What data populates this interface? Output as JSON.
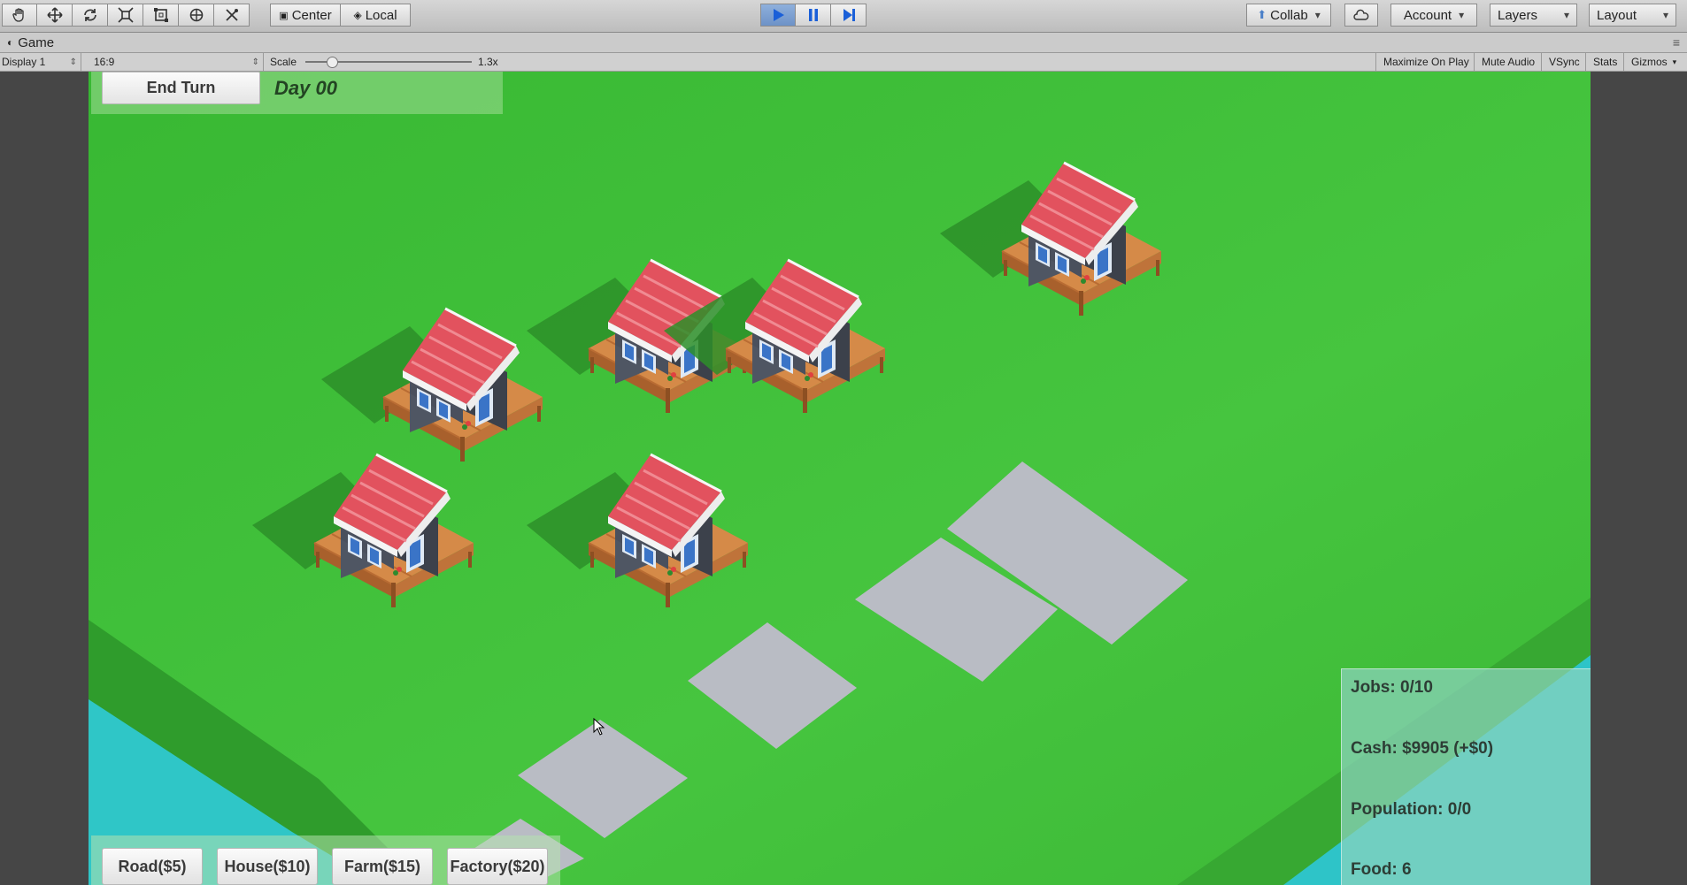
{
  "toolbar": {
    "tools": [
      "hand-tool",
      "move-tool",
      "rotate-tool",
      "scale-tool",
      "rect-tool",
      "transform-tool",
      "custom-tool"
    ],
    "pivot": "Center",
    "space": "Local",
    "collab": "Collab",
    "account": "Account",
    "layers": "Layers",
    "layout": "Layout"
  },
  "tab": {
    "title": "Game"
  },
  "controls": {
    "display": "Display 1",
    "aspect": "16:9",
    "scale_label": "Scale",
    "scale_value": "1.3x",
    "maximize": "Maximize On Play",
    "mute": "Mute Audio",
    "vsync": "VSync",
    "stats": "Stats",
    "gizmos": "Gizmos"
  },
  "game": {
    "end_turn": "End Turn",
    "day": "Day 00",
    "build": {
      "road": "Road($5)",
      "house": "House($10)",
      "farm": "Farm($15)",
      "factory": "Factory($20)"
    },
    "stats": {
      "jobs": "Jobs: 0/10",
      "cash": "Cash: $9905 (+$0)",
      "population": "Population: 0/0",
      "food": "Food: 6"
    }
  },
  "colors": {
    "grass": "#3fc03a",
    "water": "#2ec4c8",
    "roof": "#e2525e",
    "road_tile": "#b9bcc4",
    "play_active": "#6d92c7"
  }
}
